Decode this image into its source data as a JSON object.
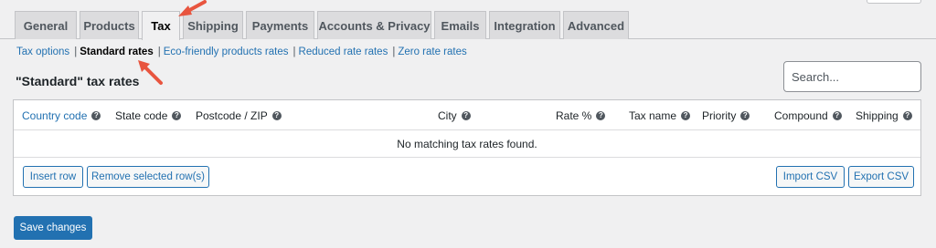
{
  "tabs": [
    {
      "label": "General"
    },
    {
      "label": "Products"
    },
    {
      "label": "Tax"
    },
    {
      "label": "Shipping"
    },
    {
      "label": "Payments"
    },
    {
      "label": "Accounts & Privacy"
    },
    {
      "label": "Emails"
    },
    {
      "label": "Integration"
    },
    {
      "label": "Advanced"
    }
  ],
  "subnav": {
    "items": [
      {
        "label": "Tax options"
      },
      {
        "label": "Standard rates"
      },
      {
        "label": "Eco-friendly products rates"
      },
      {
        "label": "Reduced rate rates"
      },
      {
        "label": "Zero rate rates"
      }
    ],
    "separator": "|"
  },
  "heading": "\"Standard\" tax rates",
  "search": {
    "placeholder": "Search..."
  },
  "table": {
    "columns": [
      "Country code",
      "State code",
      "Postcode / ZIP",
      "City",
      "Rate %",
      "Tax name",
      "Priority",
      "Compound",
      "Shipping"
    ],
    "help_glyph": "?",
    "empty_message": "No matching tax rates found."
  },
  "buttons": {
    "insert_row": "Insert row",
    "remove_rows": "Remove selected row(s)",
    "import_csv": "Import CSV",
    "export_csv": "Export CSV",
    "save": "Save changes"
  },
  "colors": {
    "accent": "#2271b1",
    "annotation_arrow": "#e8553f"
  }
}
